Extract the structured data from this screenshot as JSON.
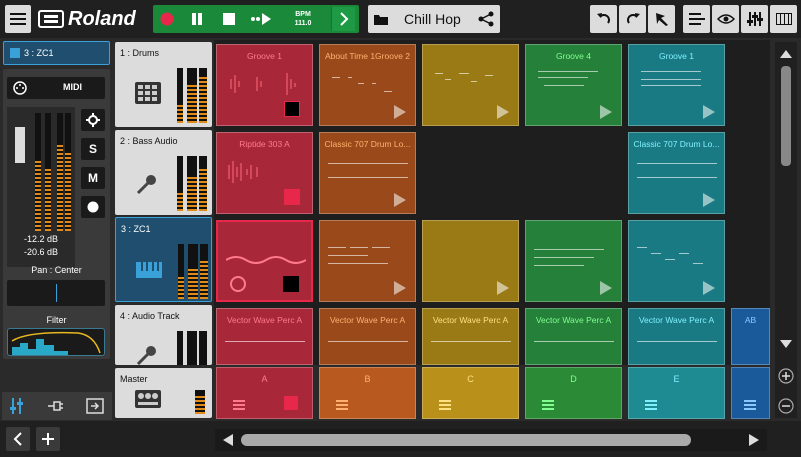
{
  "header": {
    "brand": "Roland",
    "bpm_label": "BPM",
    "bpm_value": "111.0",
    "song_name": "Chill Hop"
  },
  "left": {
    "selected_track": "3 : ZC1",
    "midi": "MIDI",
    "db_top": "-12.2 dB",
    "db_bottom": "-20.6 dB",
    "solo": "S",
    "mute": "M",
    "pan": "Pan : Center",
    "filter": "Filter"
  },
  "tracks": [
    {
      "name": "1 : Drums"
    },
    {
      "name": "2 : Bass Audio"
    },
    {
      "name": "3 : ZC1"
    },
    {
      "name": "4 : Audio Track"
    }
  ],
  "master": {
    "label": "Master",
    "scenes": [
      "A",
      "B",
      "C",
      "D",
      "E"
    ]
  },
  "clips": {
    "row1": [
      "Groove 1",
      "About Time 1Groove 2",
      "",
      "Groove 4",
      "Groove 1"
    ],
    "row2": [
      "Riptide 303 A",
      "Classic 707 Drum Lo...",
      "",
      "",
      "Classic 707 Drum Lo..."
    ],
    "row4": [
      "Vector Wave Perc A",
      "Vector Wave Perc A",
      "Vector Wave Perc A",
      "Vector Wave Perc A",
      "Vector Wave Perc A",
      "AB"
    ]
  },
  "colors": {
    "red": "#c0293f",
    "orange": "#b85a1f",
    "yellow": "#b8901a",
    "green": "#2a8a35",
    "teal": "#1e8a92",
    "accent": "#3aa0d8",
    "transport": "#1a8a3a"
  }
}
